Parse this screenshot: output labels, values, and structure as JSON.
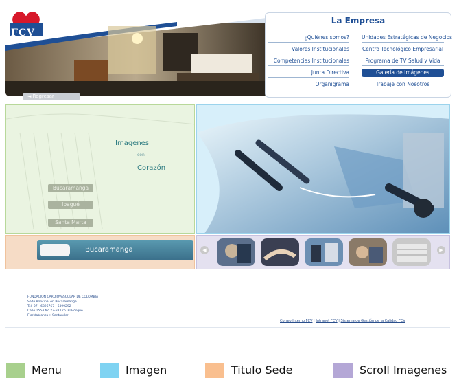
{
  "header": {
    "logo_text": "FCV",
    "panel_title": "La Empresa",
    "links_left": [
      "¿Quiénes somos?",
      "Valores Institucionales",
      "Competencias Institucionales",
      "Junta Directiva",
      "Organigrama"
    ],
    "links_right": [
      "Unidades Estratégicas de Negocios",
      "Centro Tecnológico Empresarial",
      "Programa de TV Salud y Vida",
      "Galería de Imágenes",
      "Trabaje con Nosotros"
    ],
    "active_link": "Galería de Imágenes",
    "back_label": "Regresar"
  },
  "menu": {
    "slogan_line1": "Imagenes",
    "slogan_line2": "con",
    "slogan_line3": "Corazón",
    "cities": [
      "Bucaramanga",
      "Ibagué",
      "Santa Marta"
    ]
  },
  "titulo": {
    "sede_name": "Bucaramanga"
  },
  "scroll": {
    "prev_icon": "chevron-left-icon",
    "next_icon": "chevron-right-icon",
    "thumbnail_count": 5
  },
  "footer": {
    "org_lines": [
      "FUNDACION CARDIOVASCULAR DE COLOMBIA",
      "Sede Principal en Bucaramanga",
      "Tel. 07 - 6396767 - 6399292",
      "Calle 155A No.23-58 Urb. El Bosque",
      "Floridablanca :: Santander"
    ],
    "links": [
      "Correo Interno FCV",
      "Intranet FCV",
      "Sistema de Gestión de la Calidad FCV"
    ],
    "separator": "|"
  },
  "legend": {
    "items": [
      {
        "label": "Menu",
        "color": "#a8d08d"
      },
      {
        "label": "Imagen",
        "color": "#7fd3f2"
      },
      {
        "label": "Titulo Sede",
        "color": "#f9bf8f"
      },
      {
        "label": "Scroll Imagenes",
        "color": "#b4a7d6"
      }
    ]
  },
  "colors": {
    "brand_blue": "#1f4f95",
    "menu_region": "#e7f2dc",
    "image_region": "#d7effa",
    "titulo_region": "#f6dcc6",
    "scroll_region": "#e4e1f0"
  }
}
